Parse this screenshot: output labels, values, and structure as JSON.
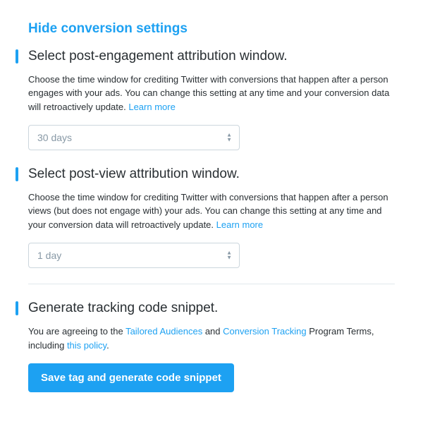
{
  "toggle": {
    "label": "Hide conversion settings"
  },
  "engagement": {
    "title": "Select post-engagement attribution window.",
    "desc1": "Choose the time window for crediting Twitter with conversions that happen after a person engages with your ads. You can change this setting at any time and your conversion data will retroactively update. ",
    "learn_more": "Learn more",
    "selected": "30 days"
  },
  "view": {
    "title": "Select post-view attribution window.",
    "desc1": "Choose the time window for crediting Twitter with conversions that happen after a person views (but does not engage with) your ads. You can change this setting at any time and your conversion data will retroactively update. ",
    "learn_more": "Learn more",
    "selected": "1 day"
  },
  "generate": {
    "title": "Generate tracking code snippet.",
    "agree_pre": "You are agreeing to the ",
    "link1": "Tailored Audiences",
    "mid1": " and ",
    "link2": "Conversion Tracking",
    "mid2": " Program Terms, including ",
    "link3": "this policy",
    "end": ".",
    "button": "Save tag and generate code snippet"
  }
}
